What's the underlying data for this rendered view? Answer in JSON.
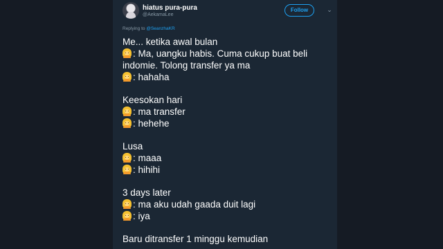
{
  "tweet": {
    "author": {
      "display_name": "hiatus pura-pura",
      "handle": "@AekamaLee"
    },
    "follow_label": "Follow",
    "reply_prefix": "Replying to",
    "reply_to": "@SeanzhaKR",
    "lines": [
      {
        "emoji": false,
        "text": "Me... ketika awal bulan"
      },
      {
        "emoji": true,
        "text": ": Ma, uangku habis. Cuma cukup buat beli"
      },
      {
        "emoji": false,
        "text": "indomie. Tolong transfer ya ma"
      },
      {
        "emoji": true,
        "text": ": hahaha"
      },
      {
        "emoji": false,
        "text": "Keesokan hari"
      },
      {
        "emoji": true,
        "text": ": ma transfer"
      },
      {
        "emoji": true,
        "text": ": hehehe"
      },
      {
        "emoji": false,
        "text": "Lusa"
      },
      {
        "emoji": true,
        "text": ": maaa"
      },
      {
        "emoji": true,
        "text": ": hihihi"
      },
      {
        "emoji": false,
        "text": "3 days later"
      },
      {
        "emoji": true,
        "text": ": ma aku udah gaada duit lagi"
      },
      {
        "emoji": true,
        "text": ": iya"
      },
      {
        "emoji": false,
        "text": "Baru ditransfer 1 minggu kemudian"
      }
    ],
    "emoji_name": "woman-emoji",
    "colors": {
      "background": "#1b2734",
      "accent": "#1da1f2",
      "muted": "#8899a6"
    }
  }
}
